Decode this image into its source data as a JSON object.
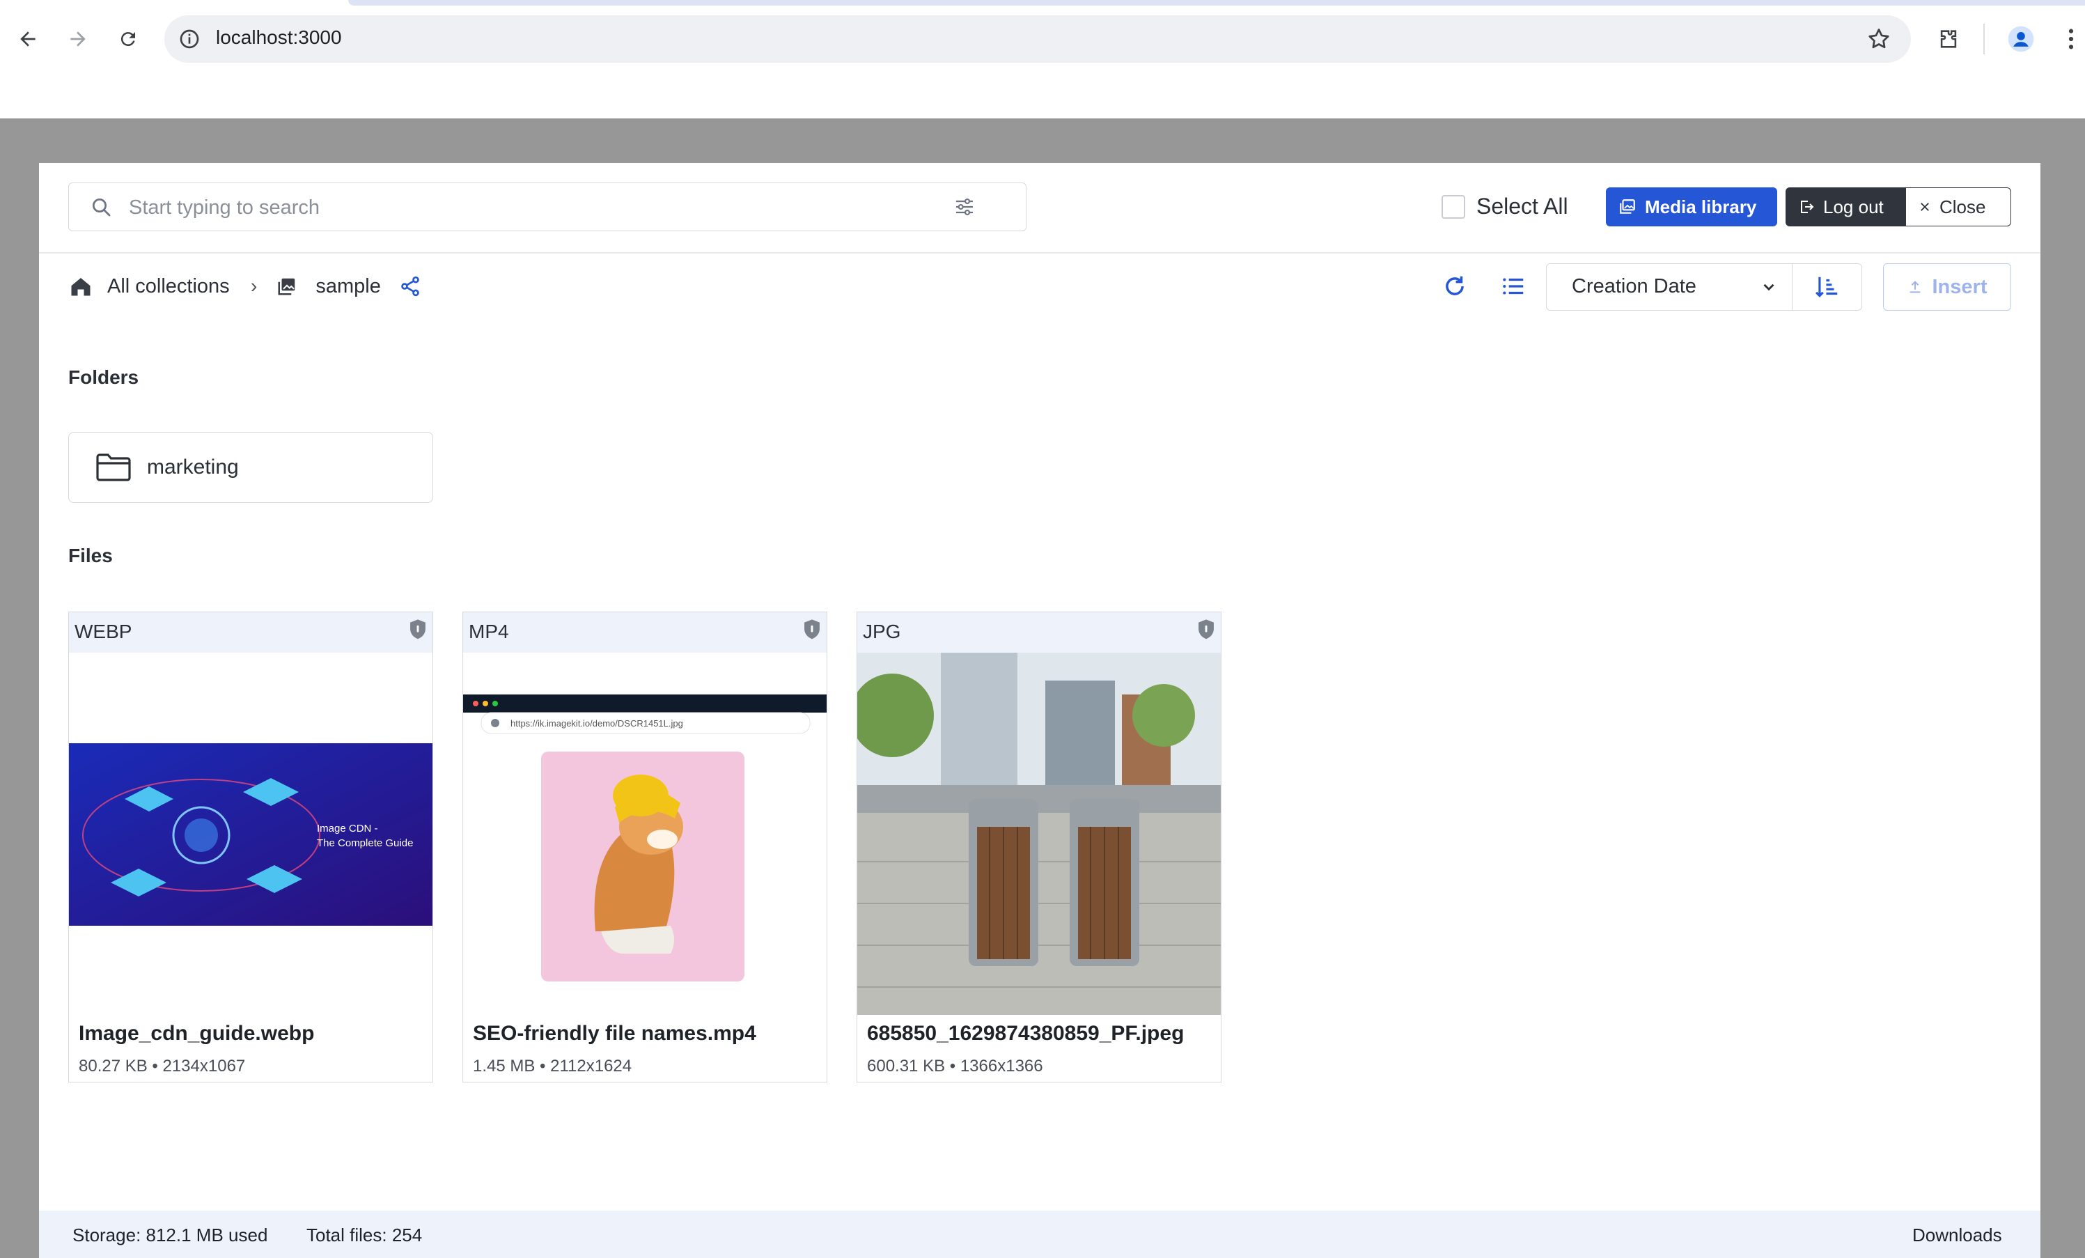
{
  "browser": {
    "url": "localhost:3000"
  },
  "toolbar": {
    "search_placeholder": "Start typing to search",
    "select_all_label": "Select All",
    "media_library_label": "Media library",
    "logout_label": "Log out",
    "close_label": "Close"
  },
  "breadcrumb": {
    "home_label": "All collections",
    "separator": "›",
    "current_label": "sample"
  },
  "controls": {
    "sort_selected": "Creation Date",
    "sort_options": [
      "Creation Date"
    ],
    "insert_label": "Insert"
  },
  "folders": {
    "title": "Folders",
    "items": [
      {
        "name": "marketing"
      }
    ]
  },
  "files": {
    "title": "Files",
    "items": [
      {
        "type": "WEBP",
        "name": "Image_cdn_guide.webp",
        "meta": "80.27 KB • 2134x1067",
        "thumb_text_1": "Image CDN -",
        "thumb_text_2": "The Complete Guide"
      },
      {
        "type": "MP4",
        "name": "SEO-friendly file names.mp4",
        "meta": "1.45 MB • 2112x1624",
        "thumb_url": "https://ik.imagekit.io/demo/DSCR1451L.jpg"
      },
      {
        "type": "JPG",
        "name": "685850_1629874380859_PF.jpeg",
        "meta": "600.31 KB • 1366x1366"
      }
    ]
  },
  "footer": {
    "storage": "Storage: 812.1 MB used",
    "total_files": "Total files: 254",
    "downloads": "Downloads"
  },
  "colors": {
    "accent": "#2456d6",
    "dark_button": "#2f343d",
    "overlay": "#979797",
    "header_tint": "#eef2fb"
  }
}
